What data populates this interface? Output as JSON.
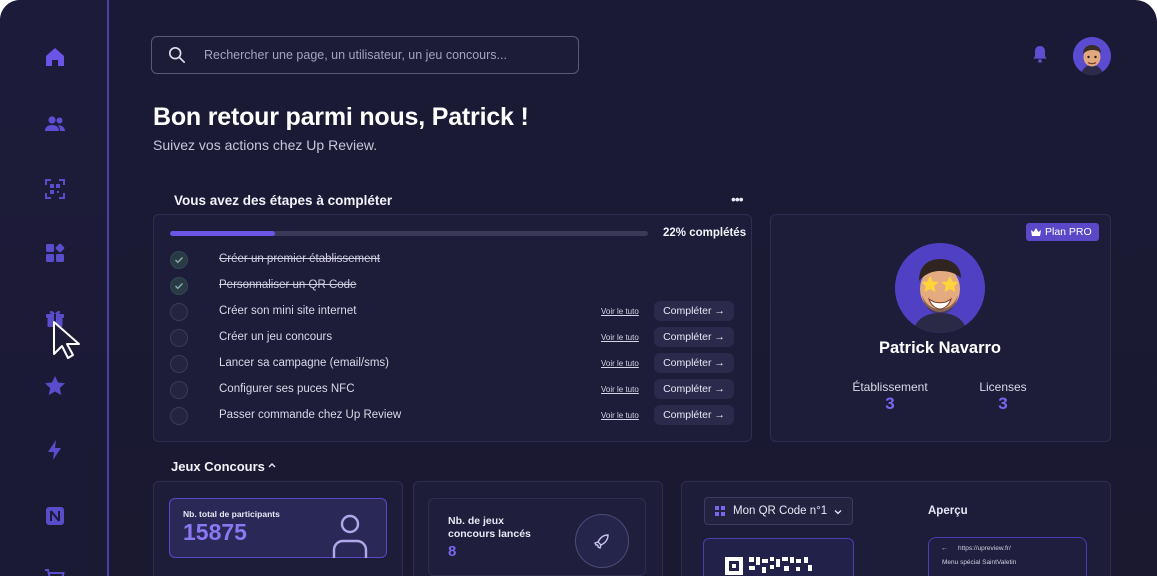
{
  "colors": {
    "accent": "#6d55e8",
    "accent_light": "#8a78f2",
    "background": "#1b1a36",
    "sidebar_border": "#4b3fa8"
  },
  "sidebar": {
    "items": [
      {
        "icon": "home-icon"
      },
      {
        "icon": "users-icon"
      },
      {
        "icon": "qr-code-icon"
      },
      {
        "icon": "widgets-icon"
      },
      {
        "icon": "gift-icon"
      },
      {
        "icon": "star-icon"
      },
      {
        "icon": "lightning-icon"
      },
      {
        "icon": "nfc-icon"
      },
      {
        "icon": "cart-icon"
      }
    ]
  },
  "header": {
    "search_placeholder": "Rechercher une page, un utilisateur, un jeu concours...",
    "notification_icon": "bell-icon",
    "avatar_icon": "user-avatar-icon"
  },
  "welcome": {
    "title": "Bon retour parmi nous, Patrick !",
    "subtitle": "Suivez vos actions chez Up Review."
  },
  "steps": {
    "title": "Vous avez des étapes à compléter",
    "more_label": "•••",
    "progress_percent": 22,
    "progress_label": "22% complétés",
    "items": [
      {
        "label": "Créer un premier établissement",
        "done": true
      },
      {
        "label": "Personnaliser un QR Code",
        "done": true
      },
      {
        "label": "Créer son mini site internet",
        "done": false,
        "tuto": "Voir le tuto",
        "action": "Compléter →"
      },
      {
        "label": "Créer un jeu concours",
        "done": false,
        "tuto": "Voir le tuto",
        "action": "Compléter →"
      },
      {
        "label": "Lancer sa campagne (email/sms)",
        "done": false,
        "tuto": "Voir le tuto",
        "action": "Compléter →"
      },
      {
        "label": "Configurer ses puces NFC",
        "done": false,
        "tuto": "Voir le tuto",
        "action": "Compléter →"
      },
      {
        "label": "Passer commande chez Up Review",
        "done": false,
        "tuto": "Voir le tuto",
        "action": "Compléter →"
      }
    ]
  },
  "profile": {
    "plan_badge": "Plan PRO",
    "name": "Patrick Navarro",
    "stats": [
      {
        "label": "Établissement",
        "value": "3"
      },
      {
        "label": "Licenses",
        "value": "3"
      }
    ]
  },
  "contests": {
    "title": "Jeux Concours",
    "participants_label": "Nb. total de participants",
    "participants_value": "15875",
    "launched_label": "Nb. de jeux concours lancés",
    "launched_value": "8",
    "qr_select_label": "Mon QR Code n°1",
    "preview_title": "Aperçu",
    "preview_back": "←",
    "preview_url": "https://upreview.fr/",
    "preview_menu": "Menu spécial SaintValetin"
  }
}
